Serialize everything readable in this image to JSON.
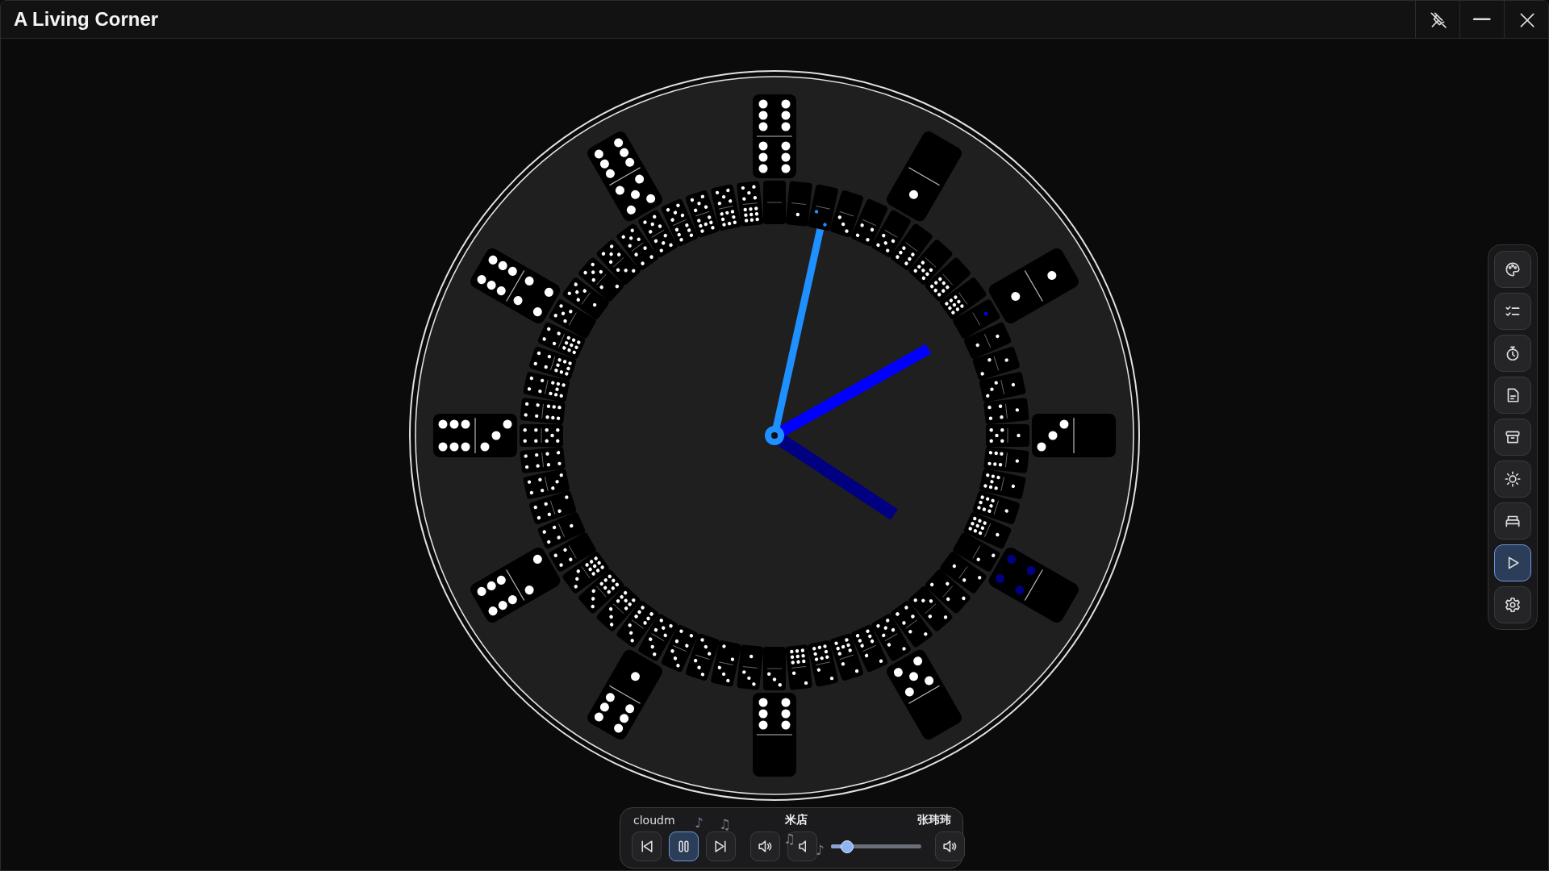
{
  "window": {
    "title": "A Living Corner",
    "buttons": [
      {
        "kind": "unpin"
      },
      {
        "kind": "minimize"
      },
      {
        "kind": "close"
      }
    ]
  },
  "sidebar": {
    "items": [
      {
        "kind": "palette",
        "selected": false
      },
      {
        "kind": "checklist",
        "selected": false
      },
      {
        "kind": "timer",
        "selected": false
      },
      {
        "kind": "document",
        "selected": false
      },
      {
        "kind": "archive",
        "selected": false
      },
      {
        "kind": "sun",
        "selected": false
      },
      {
        "kind": "bed",
        "selected": false
      },
      {
        "kind": "play",
        "selected": true
      },
      {
        "kind": "settings",
        "selected": false
      }
    ]
  },
  "player": {
    "source": "cloudm",
    "song": "米店",
    "artist": "张玮玮",
    "notes": [
      "♪",
      "♫",
      "♫",
      "♪"
    ],
    "controls": [
      {
        "kind": "previous",
        "selected": false
      },
      {
        "kind": "pause",
        "selected": true
      },
      {
        "kind": "next",
        "selected": false
      },
      {
        "kind": "volume",
        "selected": false
      },
      {
        "kind": "volume-down",
        "selected": false
      }
    ],
    "volume": {
      "level": 0.18
    },
    "end_control": {
      "kind": "volume-up",
      "selected": false
    }
  }
}
